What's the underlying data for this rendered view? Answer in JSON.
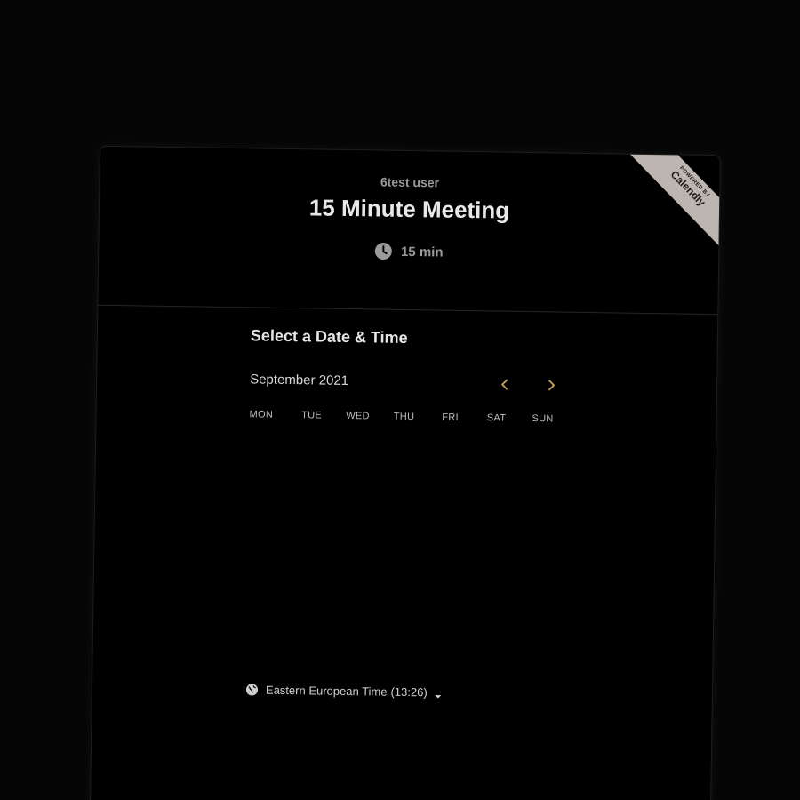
{
  "header": {
    "owner_name": "6test user",
    "event_title": "15 Minute Meeting",
    "duration": "15 min",
    "duration_icon": "clock-icon"
  },
  "badge": {
    "powered_text": "POWERED BY",
    "brand_text": "Calendly"
  },
  "calendar": {
    "section_title": "Select a Date & Time",
    "month_label": "September 2021",
    "prev_icon": "chevron-left-icon",
    "next_icon": "chevron-right-icon",
    "weekdays": [
      "MON",
      "TUE",
      "WED",
      "THU",
      "FRI",
      "SAT",
      "SUN"
    ]
  },
  "timezone": {
    "label": "Eastern European Time",
    "time": "(13:26)",
    "icon": "globe-icon",
    "caret_icon": "caret-down-icon"
  },
  "colors": {
    "accent": "#c8a25a",
    "background": "#000000",
    "ribbon": "#bdb6b0"
  }
}
